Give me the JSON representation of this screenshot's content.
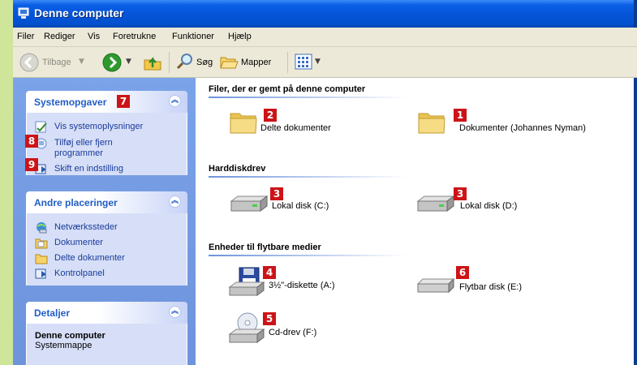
{
  "window": {
    "title": "Denne computer"
  },
  "menu": [
    "Filer",
    "Rediger",
    "Vis",
    "Foretrukne",
    "Funktioner",
    "Hjælp"
  ],
  "toolbar": {
    "back": "Tilbage",
    "search": "Søg",
    "folders": "Mapper"
  },
  "sidebar": {
    "system_tasks": {
      "title": "Systemopgaver",
      "badge": "7",
      "items": [
        {
          "label": "Vis systemoplysninger",
          "icon": "system-info-icon"
        },
        {
          "label": "Tilføj eller fjern programmer",
          "badge": "8",
          "icon": "add-remove-programs-icon"
        },
        {
          "label": "Skift en indstilling",
          "badge": "9",
          "icon": "control-panel-icon"
        }
      ]
    },
    "other_places": {
      "title": "Andre placeringer",
      "items": [
        {
          "label": "Netværkssteder",
          "icon": "network-places-icon"
        },
        {
          "label": "Dokumenter",
          "icon": "documents-icon"
        },
        {
          "label": "Delte dokumenter",
          "icon": "folder-icon"
        },
        {
          "label": "Kontrolpanel",
          "icon": "control-panel-icon"
        }
      ]
    },
    "details": {
      "title": "Detaljer",
      "name": "Denne computer",
      "type": "Systemmappe"
    }
  },
  "content": {
    "groups": [
      {
        "title": "Filer, der er gemt på denne computer",
        "items": [
          {
            "label": "Delte dokumenter",
            "badge": "2",
            "icon": "folder-icon"
          },
          {
            "label": "Dokumenter (Johannes Nyman)",
            "badge": "1",
            "icon": "folder-icon"
          }
        ]
      },
      {
        "title": "Harddiskdrev",
        "items": [
          {
            "label": "Lokal disk (C:)",
            "badge": "3",
            "icon": "hard-disk-icon"
          },
          {
            "label": "Lokal disk (D:)",
            "badge": "3",
            "icon": "hard-disk-icon"
          }
        ]
      },
      {
        "title": "Enheder til flytbare medier",
        "items": [
          {
            "label": "3½\"-diskette (A:)",
            "badge": "4",
            "icon": "floppy-drive-icon"
          },
          {
            "label": "Flytbar disk (E:)",
            "badge": "6",
            "icon": "removable-disk-icon"
          },
          {
            "label": "Cd-drev (F:)",
            "badge": "5",
            "icon": "cd-drive-icon"
          }
        ]
      }
    ]
  },
  "colors": {
    "titlebar": "#0454d6",
    "sidebar": "#6d93dc",
    "badge": "#cc1418",
    "link": "#1a3a9a",
    "background": "#cfe59a"
  }
}
